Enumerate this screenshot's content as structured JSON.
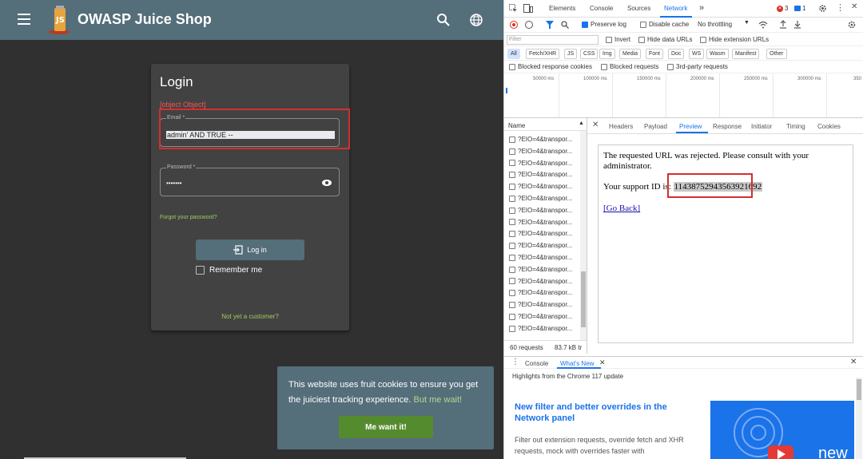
{
  "app": {
    "title": "OWASP Juice Shop",
    "login": {
      "title": "Login",
      "error": "[object Object]",
      "email_label": "Email *",
      "email_value": "admin' AND TRUE --",
      "password_label": "Password *",
      "password_value": "•••••••",
      "forgot": "Forgot your password?",
      "login_button": "Log in",
      "remember": "Remember me",
      "not_customer": "Not yet a customer?"
    },
    "cookie": {
      "text": "This website uses fruit cookies to ensure you get the juiciest tracking experience.",
      "more": "But me wait!",
      "button": "Me want it!"
    }
  },
  "devtools": {
    "tabs": [
      "Elements",
      "Console",
      "Sources",
      "Network"
    ],
    "more_tabs": "»",
    "error_count": "3",
    "message_count": "1",
    "preserve_log": "Preserve log",
    "disable_cache": "Disable cache",
    "throttling": "No throttling",
    "filter_placeholder": "Filter",
    "invert": "Invert",
    "hide_data_urls": "Hide data URLs",
    "hide_extension_urls": "Hide extension URLs",
    "type_filters": [
      "All",
      "Fetch/XHR",
      "JS",
      "CSS",
      "Img",
      "Media",
      "Font",
      "Doc",
      "WS",
      "Wasm",
      "Manifest",
      "Other"
    ],
    "blocked_cookies": "Blocked response cookies",
    "blocked_requests": "Blocked requests",
    "third_party": "3rd-party requests",
    "timeline_ticks": [
      "50000 ms",
      "100000 ms",
      "150000 ms",
      "200000 ms",
      "250000 ms",
      "300000 ms",
      "350"
    ],
    "name_header": "Name",
    "request_name": "?EIO=4&transpor...",
    "request_count": 17,
    "status": "60 requests",
    "transferred": "83.7 kB tr",
    "detail_tabs": [
      "Headers",
      "Payload",
      "Preview",
      "Response",
      "Initiator",
      "Timing",
      "Cookies"
    ],
    "preview": {
      "message": "The requested URL was rejected. Please consult with your administrator.",
      "support_label": "Your support ID is:",
      "support_id": "11438752943563921692",
      "go_back": "[Go Back]"
    },
    "drawer_tabs": [
      "Console",
      "What's New"
    ],
    "drawer_highlights": "Highlights from the Chrome 117 update",
    "feature_title": "New filter and better overrides in the Network panel",
    "feature_desc": "Filter out extension requests, override fetch and XHR requests, mock with overrides faster with",
    "video_text": "new"
  },
  "colors": {
    "toolbar": "#546e7a",
    "accent_green": "#9ccc65",
    "error_red": "#ff5252",
    "highlight_red": "#d32f2f",
    "chrome_blue": "#1a73e8"
  }
}
